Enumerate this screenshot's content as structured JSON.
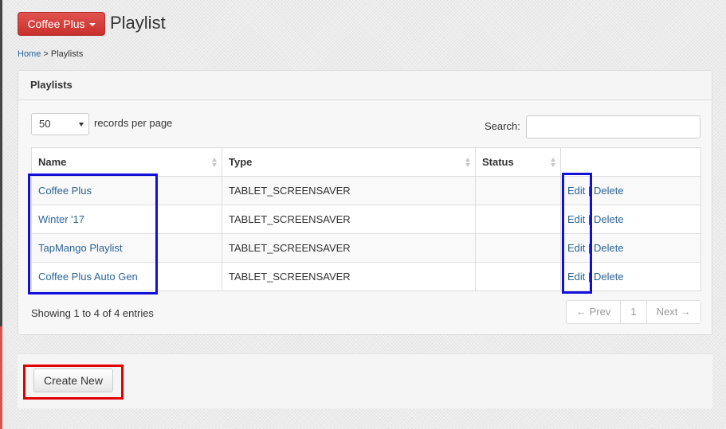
{
  "header": {
    "brand_button": "Coffee Plus",
    "title": "Playlist"
  },
  "breadcrumb": {
    "home": "Home",
    "separator": " > ",
    "current": "Playlists"
  },
  "panel": {
    "heading": "Playlists"
  },
  "controls": {
    "page_length": "50",
    "records_per_page_label": "records per page",
    "search_label": "Search:",
    "search_value": ""
  },
  "table": {
    "columns": [
      "Name",
      "Type",
      "Status",
      ""
    ],
    "rows": [
      {
        "name": "Coffee Plus",
        "type": "TABLET_SCREENSAVER",
        "status": "",
        "edit": "Edit",
        "sep": "|",
        "delete": "Delete"
      },
      {
        "name": "Winter '17",
        "type": "TABLET_SCREENSAVER",
        "status": "",
        "edit": "Edit",
        "sep": "|",
        "delete": "Delete"
      },
      {
        "name": "TapMango Playlist",
        "type": "TABLET_SCREENSAVER",
        "status": "",
        "edit": "Edit",
        "sep": "|",
        "delete": "Delete"
      },
      {
        "name": "Coffee Plus Auto Gen",
        "type": "TABLET_SCREENSAVER",
        "status": "",
        "edit": "Edit",
        "sep": "|",
        "delete": "Delete"
      }
    ]
  },
  "info_text": "Showing 1 to 4 of 4 entries",
  "pagination": {
    "prev": "← Prev",
    "page": "1",
    "next": "Next →"
  },
  "footer": {
    "create_button": "Create New"
  },
  "colors": {
    "brand": "#d9534f",
    "link": "#2a6496",
    "highlight_blue": "#1010d8",
    "highlight_red": "#e00000"
  },
  "icons": {
    "caret": "caret-down-icon",
    "sort": "sort-icon",
    "select_arrow": "chevron-down-icon"
  }
}
